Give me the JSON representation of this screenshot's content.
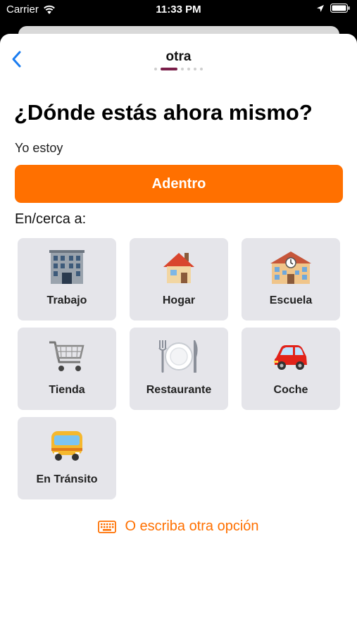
{
  "status_bar": {
    "carrier": "Carrier",
    "time": "11:33 PM"
  },
  "nav": {
    "title": "otra"
  },
  "question": "¿Dónde estás ahora mismo?",
  "subtitle": "Yo estoy",
  "primary_option": "Adentro",
  "near_label": "En/cerca a:",
  "places": [
    {
      "label": "Trabajo",
      "icon": "office-building-icon"
    },
    {
      "label": "Hogar",
      "icon": "house-icon"
    },
    {
      "label": "Escuela",
      "icon": "school-icon"
    },
    {
      "label": "Tienda",
      "icon": "shopping-cart-icon"
    },
    {
      "label": "Restaurante",
      "icon": "fork-plate-knife-icon"
    },
    {
      "label": "Coche",
      "icon": "car-icon"
    },
    {
      "label": "En Tránsito",
      "icon": "bus-icon"
    }
  ],
  "type_other": "O escriba otra opción",
  "colors": {
    "accent": "#ff7000",
    "progress": "#7a1f4a",
    "tile": "#e5e5ea",
    "link": "#1a7cf0"
  }
}
